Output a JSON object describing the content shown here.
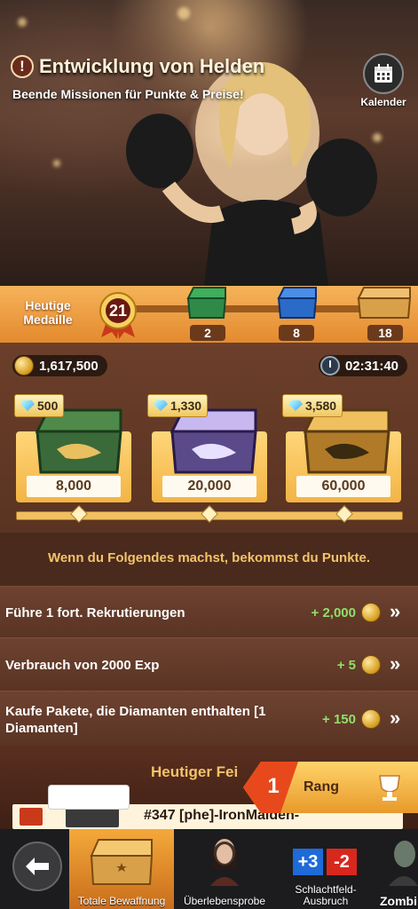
{
  "hero": {
    "title": "Entwicklung von Helden",
    "subtitle": "Beende Missionen für Punkte & Preise!",
    "calendar_label": "Kalender"
  },
  "medal_strip": {
    "label": "Heutige Medaille",
    "current": "21",
    "milestones": [
      "2",
      "8",
      "18"
    ]
  },
  "rewards": {
    "coins": "1,617,500",
    "timer": "02:31:40",
    "chests": [
      {
        "gems": "500",
        "points": "8,000"
      },
      {
        "gems": "1,330",
        "points": "20,000"
      },
      {
        "gems": "3,580",
        "points": "60,000"
      }
    ]
  },
  "hint": "Wenn du Folgendes machst, bekommst du Punkte.",
  "tasks": [
    {
      "text": "Führe 1 fort. Rekrutierungen",
      "points": "+ 2,000"
    },
    {
      "text": "Verbrauch von 2000 Exp",
      "points": "+ 5"
    },
    {
      "text": "Kaufe Pakete, die Diamanten enthalten [1 Diamanten]",
      "points": "+ 150"
    }
  ],
  "fest": {
    "title": "Heutiger Fei",
    "rank_num": "1",
    "rank_label": "Rang",
    "row_text": "#347 [phe]-IronMaiden-",
    "emojis": "😎 😎 😎"
  },
  "nav": {
    "tabs": [
      {
        "label": "Totale Bewaffnung"
      },
      {
        "label": "Überlebensprobe"
      },
      {
        "label": "Schlachtfeld-Ausbruch"
      },
      {
        "label": "Zombi"
      }
    ],
    "score_a": "+3",
    "score_b": "-2"
  },
  "colors": {
    "accent": "#f4a93a",
    "points_green": "#8fe06a",
    "hint_gold": "#f3c36a"
  }
}
